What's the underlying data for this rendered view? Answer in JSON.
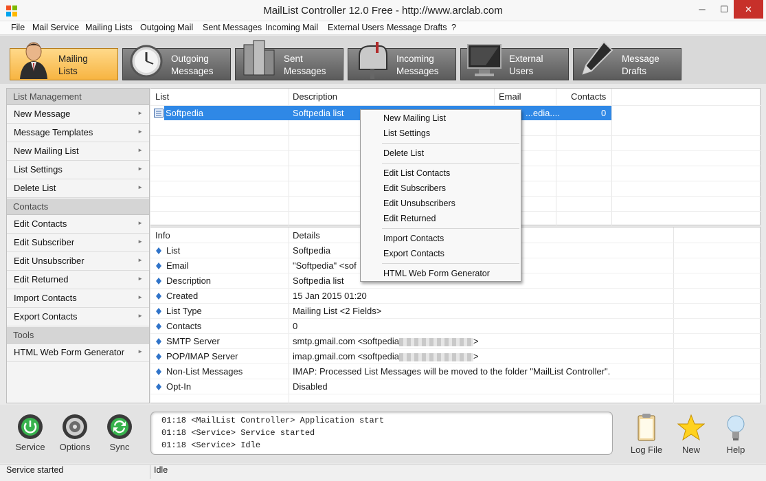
{
  "window": {
    "title": "MailList Controller 12.0 Free - http://www.arclab.com",
    "minimize": "─",
    "maximize": "☐",
    "close": "✕"
  },
  "menu": [
    "File",
    "Mail Service",
    "Mailing Lists",
    "Outgoing Mail",
    "Sent Messages",
    "Incoming Mail",
    "External Users",
    "Message Drafts",
    "?"
  ],
  "toolbar": [
    {
      "label": "Mailing\nLists",
      "icon": "user-icon",
      "active": true
    },
    {
      "label": "Outgoing\nMessages",
      "icon": "clock-icon",
      "active": false
    },
    {
      "label": "Sent\nMessages",
      "icon": "buildings-icon",
      "active": false
    },
    {
      "label": "Incoming\nMessages",
      "icon": "mailbox-icon",
      "active": false
    },
    {
      "label": "External\nUsers",
      "icon": "monitor-icon",
      "active": false
    },
    {
      "label": "Message\nDrafts",
      "icon": "pen-icon",
      "active": false
    }
  ],
  "sidebar": {
    "sections": [
      {
        "title": "List Management",
        "items": [
          "New Message",
          "Message Templates",
          "New Mailing List",
          "List Settings",
          "Delete List"
        ]
      },
      {
        "title": "Contacts",
        "items": [
          "Edit Contacts",
          "Edit Subscriber",
          "Edit Unsubscriber",
          "Edit Returned",
          "Import Contacts",
          "Export Contacts"
        ]
      },
      {
        "title": "Tools",
        "items": [
          "HTML Web Form Generator"
        ]
      }
    ],
    "arrow": "►"
  },
  "list": {
    "columns": [
      "List",
      "Description",
      "Email",
      "Contacts"
    ],
    "rows": [
      {
        "list": "Softpedia",
        "description": "Softpedia list",
        "email": "...edia....",
        "contacts": "0"
      }
    ]
  },
  "context_menu": {
    "items": [
      "New Mailing List",
      "List Settings",
      "Delete List",
      "Edit List Contacts",
      "Edit Subscribers",
      "Edit Unsubscribers",
      "Edit Returned",
      "Import Contacts",
      "Export Contacts",
      "HTML Web Form Generator"
    ]
  },
  "info": {
    "columns": [
      "Info",
      "Details"
    ],
    "rows": [
      {
        "key": "List",
        "value": "Softpedia"
      },
      {
        "key": "Email",
        "value": "\"Softpedia\" <sof"
      },
      {
        "key": "Description",
        "value": "Softpedia list"
      },
      {
        "key": "Created",
        "value": "15 Jan 2015 01:20"
      },
      {
        "key": "List Type",
        "value": "Mailing List <2 Fields>"
      },
      {
        "key": "Contacts",
        "value": "0"
      },
      {
        "key": "SMTP Server",
        "value": "smtp.gmail.com <softpedia",
        "tail": ">",
        "blurred": true
      },
      {
        "key": "POP/IMAP Server",
        "value": "imap.gmail.com <softpedia",
        "tail": ">",
        "blurred": true
      },
      {
        "key": "Non-List Messages",
        "value": "IMAP: Processed List Messages will be moved to the folder \"MailList Controller\"."
      },
      {
        "key": "Opt-In",
        "value": "Disabled"
      }
    ]
  },
  "bottom": {
    "left_buttons": [
      {
        "label": "Service",
        "icon": "power-icon"
      },
      {
        "label": "Options",
        "icon": "options-icon"
      },
      {
        "label": "Sync",
        "icon": "sync-icon"
      }
    ],
    "log": [
      "01:18 <MailList Controller> Application start",
      "01:18 <Service> Service started",
      "01:18 <Service> Idle"
    ],
    "right_buttons": [
      {
        "label": "Log File",
        "icon": "clipboard-icon"
      },
      {
        "label": "New",
        "icon": "star-icon"
      },
      {
        "label": "Help",
        "icon": "lightbulb-icon"
      }
    ]
  },
  "status": {
    "left": "Service started",
    "right": "Idle"
  }
}
